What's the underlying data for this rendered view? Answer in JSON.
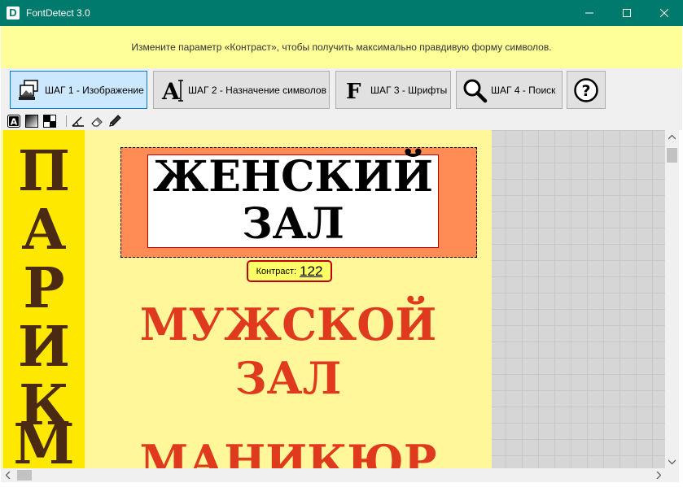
{
  "window": {
    "icon_letter": "D",
    "title": "FontDetect 3.0"
  },
  "hint": "Измените параметр «Контраст», чтобы получить максимально правдивую форму символов.",
  "steps": [
    {
      "label": "ШАГ 1 - Изображение",
      "icon": "image-icon",
      "active": true
    },
    {
      "label": "ШАГ 2 - Назначение символов",
      "icon": "letter-a-icon",
      "active": false
    },
    {
      "label": "ШАГ 3 - Шрифты",
      "icon": "letter-f-icon",
      "active": false
    },
    {
      "label": "ШАГ 4 - Поиск",
      "icon": "magnifier-icon",
      "active": false
    }
  ],
  "help_glyph": "?",
  "tools": [
    "auto-contrast-icon",
    "gradient-icon",
    "threshold-icon",
    "rotate-angle-icon",
    "eraser-icon",
    "pencil-icon"
  ],
  "tool_letter": "A",
  "image": {
    "vertical_letters": [
      "П",
      "А",
      "Р",
      "И",
      "К",
      "М"
    ],
    "selected_sign": [
      "ЖЕНСКИЙ",
      "ЗАЛ"
    ],
    "red_text": [
      "МУЖСКОЙ",
      "ЗАЛ",
      "МАНИКЮР"
    ]
  },
  "contrast": {
    "label": "Контраст:",
    "value": "122"
  },
  "colors": {
    "titlebar": "#007a6c",
    "hint_bg": "#ffff99",
    "photo_bg": "#fff799",
    "strip": "#ffe800",
    "selection": "#ff8c55",
    "red_text": "#e03a1e",
    "brown_text": "#4a2a12"
  }
}
